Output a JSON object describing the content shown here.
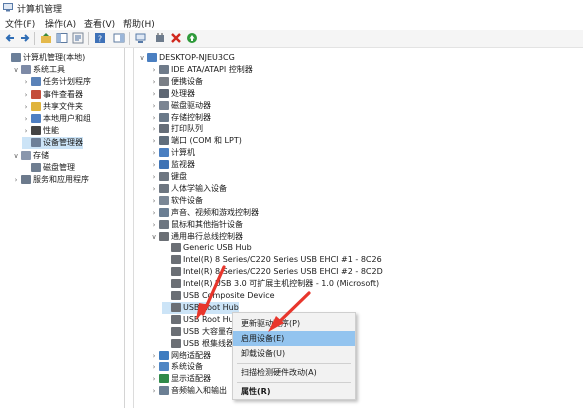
{
  "window": {
    "title": "计算机管理"
  },
  "menu": [
    "文件(F)",
    "操作(A)",
    "查看(V)",
    "帮助(H)"
  ],
  "left_tree": [
    {
      "label": "计算机管理(本地)",
      "indent": 0,
      "expander": "",
      "icon": "computer-management-icon",
      "color": "#6b7f99"
    },
    {
      "label": "系统工具",
      "indent": 1,
      "expander": "v",
      "icon": "tools-icon",
      "color": "#7d8aa6"
    },
    {
      "label": "任务计划程序",
      "indent": 2,
      "expander": ">",
      "icon": "task-scheduler-icon",
      "color": "#5a82b8"
    },
    {
      "label": "事件查看器",
      "indent": 2,
      "expander": ">",
      "icon": "event-viewer-icon",
      "color": "#c44d3a"
    },
    {
      "label": "共享文件夹",
      "indent": 2,
      "expander": ">",
      "icon": "shared-folder-icon",
      "color": "#e0b43c"
    },
    {
      "label": "本地用户和组",
      "indent": 2,
      "expander": ">",
      "icon": "users-icon",
      "color": "#4f7fc2"
    },
    {
      "label": "性能",
      "indent": 2,
      "expander": ">",
      "icon": "performance-icon",
      "color": "#444444"
    },
    {
      "label": "设备管理器",
      "indent": 2,
      "expander": "",
      "icon": "device-manager-icon",
      "color": "#6d7f98",
      "selected": true
    },
    {
      "label": "存储",
      "indent": 1,
      "expander": "v",
      "icon": "storage-icon",
      "color": "#8a97ad"
    },
    {
      "label": "磁盘管理",
      "indent": 2,
      "expander": "",
      "icon": "disk-icon",
      "color": "#6f7e91"
    },
    {
      "label": "服务和应用程序",
      "indent": 1,
      "expander": ">",
      "icon": "services-icon",
      "color": "#6c7a8c"
    }
  ],
  "device_tree": [
    {
      "label": "DESKTOP-NJEU3CG",
      "indent": 0,
      "expander": "v",
      "icon": "computer-icon",
      "color": "#4a7fc1"
    },
    {
      "label": "IDE ATA/ATAPI 控制器",
      "indent": 1,
      "expander": ">",
      "icon": "ide-controller-icon",
      "color": "#6f7b8a"
    },
    {
      "label": "便携设备",
      "indent": 1,
      "expander": ">",
      "icon": "portable-device-icon",
      "color": "#7a7f86"
    },
    {
      "label": "处理器",
      "indent": 1,
      "expander": ">",
      "icon": "processor-icon",
      "color": "#5d6673"
    },
    {
      "label": "磁盘驱动器",
      "indent": 1,
      "expander": ">",
      "icon": "disk-drive-icon",
      "color": "#7b8593"
    },
    {
      "label": "存储控制器",
      "indent": 1,
      "expander": ">",
      "icon": "storage-controller-icon",
      "color": "#6a7989"
    },
    {
      "label": "打印队列",
      "indent": 1,
      "expander": ">",
      "icon": "printer-icon",
      "color": "#656d78"
    },
    {
      "label": "端口 (COM 和 LPT)",
      "indent": 1,
      "expander": ">",
      "icon": "port-icon",
      "color": "#5f6d7c"
    },
    {
      "label": "计算机",
      "indent": 1,
      "expander": ">",
      "icon": "computer-icon",
      "color": "#4a7fc1"
    },
    {
      "label": "监视器",
      "indent": 1,
      "expander": ">",
      "icon": "monitor-icon",
      "color": "#3f73b5"
    },
    {
      "label": "键盘",
      "indent": 1,
      "expander": ">",
      "icon": "keyboard-icon",
      "color": "#6d7681"
    },
    {
      "label": "人体学输入设备",
      "indent": 1,
      "expander": ">",
      "icon": "hid-icon",
      "color": "#6d7681"
    },
    {
      "label": "软件设备",
      "indent": 1,
      "expander": ">",
      "icon": "software-device-icon",
      "color": "#7a8796"
    },
    {
      "label": "声音、视频和游戏控制器",
      "indent": 1,
      "expander": ">",
      "icon": "sound-icon",
      "color": "#6b7f94"
    },
    {
      "label": "鼠标和其他指针设备",
      "indent": 1,
      "expander": ">",
      "icon": "mouse-icon",
      "color": "#6d7681"
    },
    {
      "label": "通用串行总线控制器",
      "indent": 1,
      "expander": "v",
      "icon": "usb-icon",
      "color": "#6b6f75"
    },
    {
      "label": "Generic USB Hub",
      "indent": 2,
      "expander": "",
      "icon": "usb-icon",
      "color": "#6b6f75"
    },
    {
      "label": "Intel(R) 8 Series/C220 Series USB EHCI #1 - 8C26",
      "indent": 2,
      "expander": "",
      "icon": "usb-icon",
      "color": "#6b6f75"
    },
    {
      "label": "Intel(R) 8 Series/C220 Series USB EHCI #2 - 8C2D",
      "indent": 2,
      "expander": "",
      "icon": "usb-icon",
      "color": "#6b6f75"
    },
    {
      "label": "Intel(R) USB 3.0 可扩展主机控制器 - 1.0 (Microsoft)",
      "indent": 2,
      "expander": "",
      "icon": "usb-icon",
      "color": "#6b6f75"
    },
    {
      "label": "USB Composite Device",
      "indent": 2,
      "expander": "",
      "icon": "usb-icon",
      "color": "#6b6f75"
    },
    {
      "label": "USB Root Hub",
      "indent": 2,
      "expander": "",
      "icon": "usb-disabled-icon",
      "color": "#6b6f75",
      "selected": true
    },
    {
      "label": "USB Root Hub",
      "indent": 2,
      "expander": "",
      "icon": "usb-icon",
      "color": "#6b6f75"
    },
    {
      "label": "USB 大容量存储设备",
      "indent": 2,
      "expander": "",
      "icon": "usb-icon",
      "color": "#6b6f75"
    },
    {
      "label": "USB 根集线器",
      "indent": 2,
      "expander": "",
      "icon": "usb-icon",
      "color": "#6b6f75"
    },
    {
      "label": "网络适配器",
      "indent": 1,
      "expander": ">",
      "icon": "network-adapter-icon",
      "color": "#3e7cc0"
    },
    {
      "label": "系统设备",
      "indent": 1,
      "expander": ">",
      "icon": "system-device-icon",
      "color": "#4f86c4"
    },
    {
      "label": "显示适配器",
      "indent": 1,
      "expander": ">",
      "icon": "display-adapter-icon",
      "color": "#2f8a4a"
    },
    {
      "label": "音频输入和输出",
      "indent": 1,
      "expander": ">",
      "icon": "audio-icon",
      "color": "#6b7f94"
    }
  ],
  "context_menu": [
    {
      "label": "更新驱动程序(P)",
      "highlighted": false
    },
    {
      "label": "启用设备(E)",
      "highlighted": true
    },
    {
      "label": "卸载设备(U)",
      "highlighted": false
    },
    {
      "label": "扫描检测硬件改动(A)",
      "highlighted": false
    },
    {
      "label": "属性(R)",
      "highlighted": false
    }
  ],
  "annotation": {
    "arrow_color": "#e8362c"
  }
}
